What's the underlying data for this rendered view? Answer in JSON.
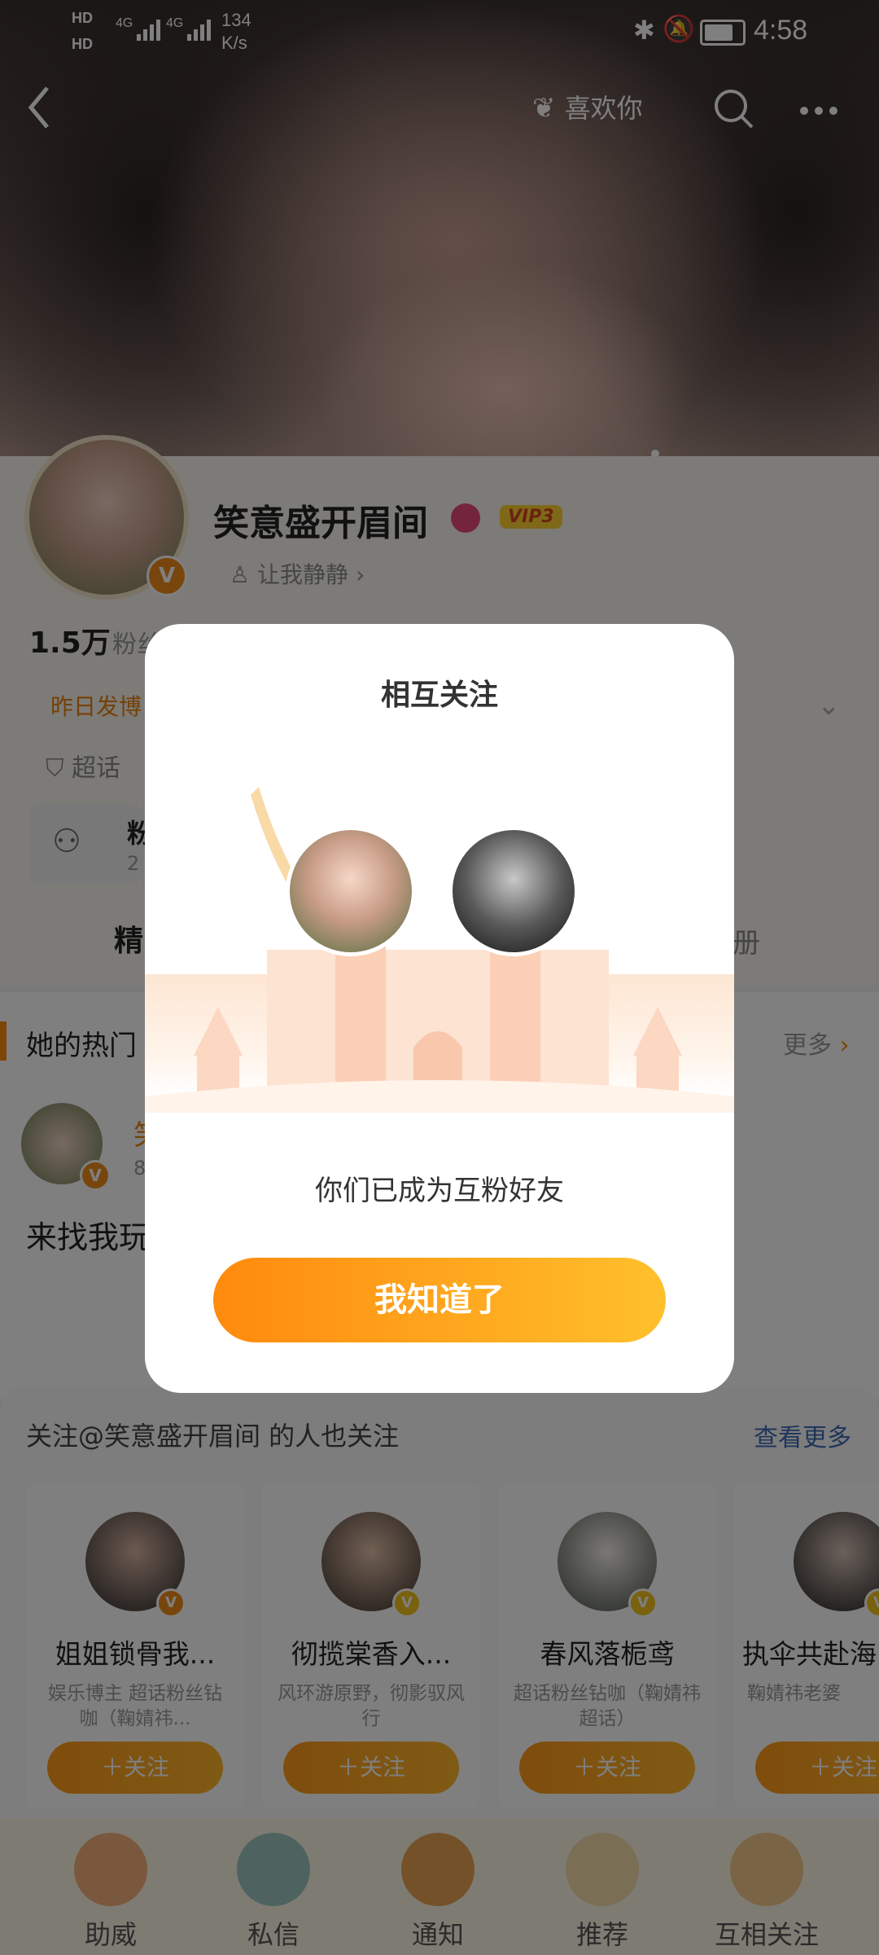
{
  "status_bar": {
    "network_1": "HD",
    "network_2": "HD",
    "signal_1": "4G",
    "signal_2": "4G",
    "speed_value": "134",
    "speed_unit": "K/s",
    "time": "4:58"
  },
  "header": {
    "like_label": "喜欢你"
  },
  "profile": {
    "name": "笑意盛开眉间",
    "vip": "VIP3",
    "sub_label": "让我静静",
    "fans_count": "1.5万",
    "fans_label_partial": "粉丝",
    "post_status": "昨日发博",
    "supertopic_partial": "超话",
    "group_partial": "粉",
    "group_sub_partial": "2",
    "featured_partial": "精",
    "album_partial": "册",
    "hot_title": "她的热门",
    "more_label": "更多",
    "feed_name_partial": "笑",
    "feed_sub_partial": "8",
    "feed_text": "来找我玩"
  },
  "modal": {
    "title": "相互关注",
    "message": "你们已成为互粉好友",
    "button_label": "我知道了"
  },
  "suggestions": {
    "title": "关注@笑意盛开眉间 的人也关注",
    "more_label": "查看更多",
    "cards": [
      {
        "name": "姐姐锁骨我...",
        "desc": "娱乐博主 超话粉丝钻咖（鞠婧祎...",
        "follow": "＋关注"
      },
      {
        "name": "彻揽棠香入...",
        "desc": "风环游原野，彻影驭风行",
        "follow": "＋关注"
      },
      {
        "name": "春风落栀鸢",
        "desc": "超话粉丝钻咖（鞠婧祎超话）",
        "follow": "＋关注"
      },
      {
        "name": "执伞共赴海",
        "desc": "鞠婧祎老婆",
        "follow": "＋关注"
      }
    ]
  },
  "tabbar": {
    "tabs": [
      {
        "label": "助威"
      },
      {
        "label": "私信"
      },
      {
        "label": "通知"
      },
      {
        "label": "推荐"
      },
      {
        "label": "互相关注"
      }
    ]
  },
  "colors": {
    "accent_orange": "#ff8a0e",
    "accent_yellow": "#ffc02c",
    "link_blue": "#3f6bb5"
  }
}
